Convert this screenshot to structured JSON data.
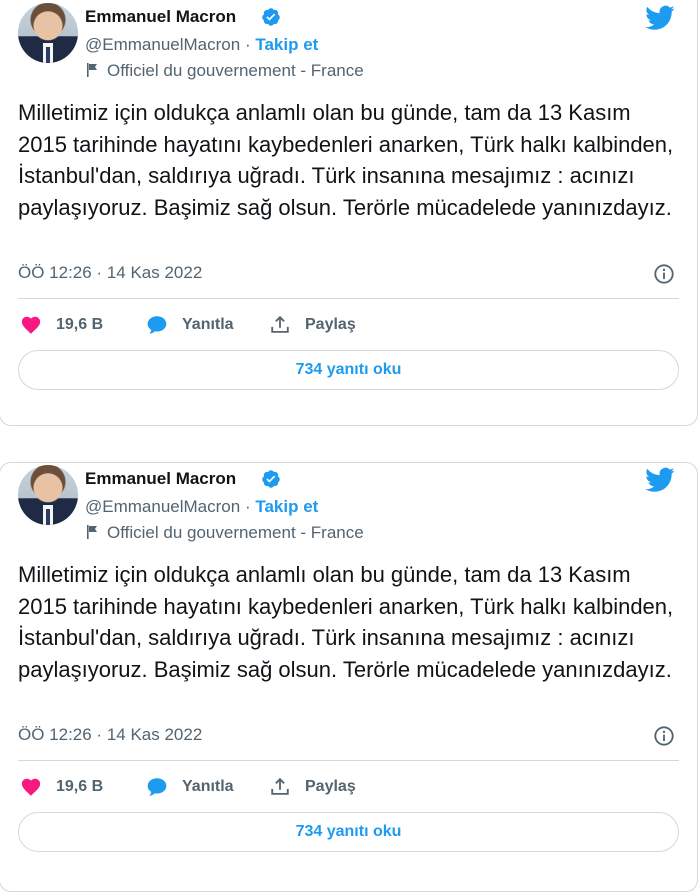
{
  "tweets": [
    {
      "author": {
        "name": "Emmanuel Macron",
        "handle": "@EmmanuelMacron",
        "separator": "·",
        "follow_label": "Takip et",
        "account_label": "Officiel du gouvernement - France"
      },
      "text": "Milletimiz için oldukça anlamlı olan bu günde, tam da 13 Kasım 2015 tarihinde hayatını kaybedenleri anarken, Türk halkı kalbinden, İstanbul'dan, saldırıya uğradı. Türk insanına mesajımız : acınızı paylaşıyoruz. Başimiz sağ olsun. Terörle mücadelede yanınızdayız.",
      "timestamp": "ÖÖ 12:26 · 14 Kas 2022",
      "actions": {
        "likes": "19,6 B",
        "reply_label": "Yanıtla",
        "share_label": "Paylaş"
      },
      "read_replies_label": "734 yanıtı oku"
    },
    {
      "author": {
        "name": "Emmanuel Macron",
        "handle": "@EmmanuelMacron",
        "separator": "·",
        "follow_label": "Takip et",
        "account_label": "Officiel du gouvernement - France"
      },
      "text": "Milletimiz için oldukça anlamlı olan bu günde, tam da 13 Kasım 2015 tarihinde hayatını kaybedenleri anarken, Türk halkı kalbinden, İstanbul'dan, saldırıya uğradı. Türk insanına mesajımız : acınızı paylaşıyoruz. Başimiz sağ olsun. Terörle mücadelede yanınızdayız.",
      "timestamp": "ÖÖ 12:26 · 14 Kas 2022",
      "actions": {
        "likes": "19,6 B",
        "reply_label": "Yanıtla",
        "share_label": "Paylaş"
      },
      "read_replies_label": "734 yanıtı oku"
    }
  ],
  "colors": {
    "accent": "#1d9bf0",
    "like": "#f91880",
    "muted": "#536471",
    "border": "#cfd9de"
  },
  "icons": [
    "verified-badge-icon",
    "twitter-bird-icon",
    "government-flag-icon",
    "info-icon",
    "heart-icon",
    "reply-bubble-icon",
    "share-icon"
  ]
}
